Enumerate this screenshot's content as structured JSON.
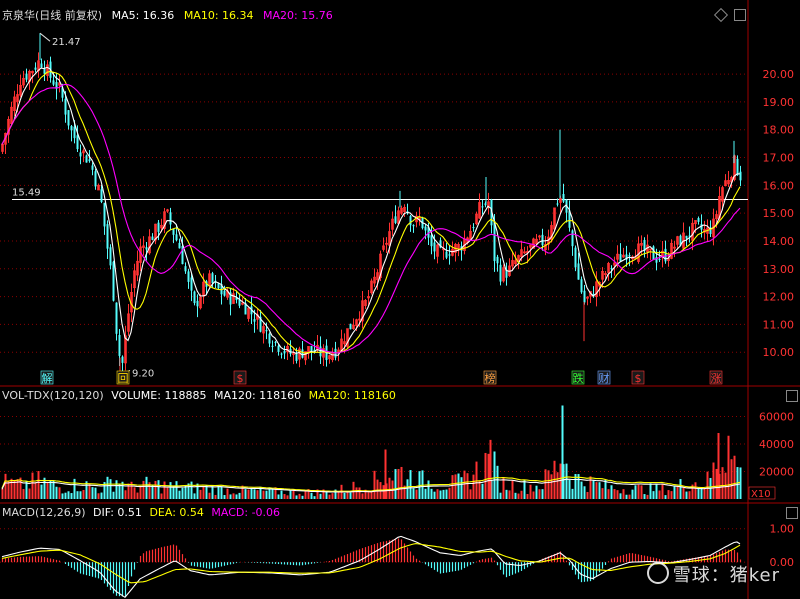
{
  "header": {
    "stock": "京泉华(日线 前复权)",
    "ma5": "MA5: 16.36",
    "ma10": "MA10: 16.34",
    "ma20": "MA20: 15.76"
  },
  "volume_header": {
    "title": "VOL-TDX(120,120)",
    "volume": "VOLUME: 118885",
    "ma120a": "MA120: 118160",
    "ma120b": "MA120: 118160"
  },
  "macd_header": {
    "title": "MACD(12,26,9)",
    "dif": "DIF: 0.51",
    "dea": "DEA: 0.54",
    "macd": "MACD: -0.06"
  },
  "watermark": "雪球：猪ker",
  "colors": {
    "up": "#ff3232",
    "down": "#54fcfc",
    "ma5": "#ffffff",
    "ma10": "#ffff00",
    "ma20": "#ff00ff",
    "grid": "#8b0000",
    "axis_text": "#ff3333"
  },
  "chart_data": [
    {
      "type": "candlestick",
      "title": "京泉华(日线 前复权)",
      "y_ticks": [
        "20.00",
        "19.00",
        "18.00",
        "17.00",
        "16.00",
        "15.00",
        "14.00",
        "13.00",
        "12.00",
        "11.00",
        "10.00"
      ],
      "ylim": [
        9.0,
        21.8
      ],
      "reference_line": {
        "value": 15.49,
        "label": "15.49"
      },
      "annotations": [
        {
          "label": "21.47",
          "value": 21.47,
          "x": 40
        },
        {
          "label": "9.20",
          "value": 9.2,
          "x": 120
        }
      ],
      "event_markers": [
        {
          "label": "解",
          "x": 47,
          "color": "#54fcfc"
        },
        {
          "label": "回",
          "x": 123,
          "color": "#ffd700"
        },
        {
          "label": "$",
          "x": 240,
          "color": "#ff3232"
        },
        {
          "label": "榜",
          "x": 490,
          "color": "#ffa040"
        },
        {
          "label": "跌",
          "x": 578,
          "color": "#32ff32"
        },
        {
          "label": "财",
          "x": 604,
          "color": "#6aa0ff"
        },
        {
          "label": "$",
          "x": 638,
          "color": "#ff3232"
        },
        {
          "label": "涨",
          "x": 716,
          "color": "#ff3232"
        }
      ],
      "close_keypoints": [
        [
          0,
          17.2
        ],
        [
          10,
          18.6
        ],
        [
          20,
          19.8
        ],
        [
          30,
          20.1
        ],
        [
          40,
          20.5
        ],
        [
          50,
          19.9
        ],
        [
          60,
          19.4
        ],
        [
          70,
          18.0
        ],
        [
          80,
          17.3
        ],
        [
          90,
          16.8
        ],
        [
          100,
          15.6
        ],
        [
          106,
          14.0
        ],
        [
          112,
          12.5
        ],
        [
          118,
          10.0
        ],
        [
          122,
          9.6
        ],
        [
          128,
          11.4
        ],
        [
          134,
          12.9
        ],
        [
          140,
          13.7
        ],
        [
          150,
          14.1
        ],
        [
          160,
          14.6
        ],
        [
          166,
          15.0
        ],
        [
          172,
          14.4
        ],
        [
          180,
          13.7
        ],
        [
          188,
          12.4
        ],
        [
          194,
          11.6
        ],
        [
          200,
          12.1
        ],
        [
          208,
          12.6
        ],
        [
          216,
          12.3
        ],
        [
          226,
          12.0
        ],
        [
          236,
          11.9
        ],
        [
          246,
          11.6
        ],
        [
          256,
          11.2
        ],
        [
          266,
          10.7
        ],
        [
          276,
          10.3
        ],
        [
          286,
          10.0
        ],
        [
          296,
          9.9
        ],
        [
          306,
          10.1
        ],
        [
          316,
          10.0
        ],
        [
          326,
          9.9
        ],
        [
          336,
          10.1
        ],
        [
          346,
          10.7
        ],
        [
          356,
          11.3
        ],
        [
          366,
          11.8
        ],
        [
          376,
          12.8
        ],
        [
          386,
          14.0
        ],
        [
          396,
          15.0
        ],
        [
          404,
          15.4
        ],
        [
          412,
          14.6
        ],
        [
          420,
          14.8
        ],
        [
          430,
          13.8
        ],
        [
          440,
          13.5
        ],
        [
          450,
          13.7
        ],
        [
          460,
          13.8
        ],
        [
          470,
          14.4
        ],
        [
          480,
          15.2
        ],
        [
          488,
          15.4
        ],
        [
          494,
          13.4
        ],
        [
          500,
          12.8
        ],
        [
          508,
          12.9
        ],
        [
          516,
          13.3
        ],
        [
          526,
          13.6
        ],
        [
          536,
          13.9
        ],
        [
          546,
          14.0
        ],
        [
          556,
          15.4
        ],
        [
          562,
          15.6
        ],
        [
          570,
          14.2
        ],
        [
          578,
          12.6
        ],
        [
          584,
          11.8
        ],
        [
          590,
          12.0
        ],
        [
          596,
          12.4
        ],
        [
          606,
          12.9
        ],
        [
          616,
          13.3
        ],
        [
          626,
          13.6
        ],
        [
          636,
          13.7
        ],
        [
          646,
          13.6
        ],
        [
          656,
          13.4
        ],
        [
          666,
          13.5
        ],
        [
          676,
          13.9
        ],
        [
          686,
          14.2
        ],
        [
          696,
          14.5
        ],
        [
          706,
          14.3
        ],
        [
          714,
          14.6
        ],
        [
          720,
          15.8
        ],
        [
          728,
          16.3
        ],
        [
          734,
          16.8
        ],
        [
          742,
          16.2
        ]
      ]
    },
    {
      "type": "bar",
      "title": "VOL-TDX(120,120)",
      "y_ticks": [
        "60000",
        "40000",
        "20000"
      ],
      "ylim": [
        0,
        72000
      ],
      "unit_label": "X10",
      "ma120_value": 11816,
      "volume_keypoints": [
        [
          0,
          14000
        ],
        [
          20,
          11000
        ],
        [
          40,
          15000
        ],
        [
          60,
          9000
        ],
        [
          80,
          12000
        ],
        [
          100,
          8000
        ],
        [
          115,
          16000
        ],
        [
          130,
          9000
        ],
        [
          150,
          12000
        ],
        [
          170,
          10000
        ],
        [
          200,
          9000
        ],
        [
          230,
          7000
        ],
        [
          260,
          6500
        ],
        [
          290,
          5500
        ],
        [
          320,
          5500
        ],
        [
          345,
          8000
        ],
        [
          370,
          13000
        ],
        [
          385,
          18000
        ],
        [
          400,
          22000
        ],
        [
          420,
          15000
        ],
        [
          440,
          12000
        ],
        [
          460,
          13000
        ],
        [
          480,
          24000
        ],
        [
          490,
          32000
        ],
        [
          500,
          13000
        ],
        [
          520,
          10000
        ],
        [
          540,
          11000
        ],
        [
          556,
          26000
        ],
        [
          562,
          40000
        ],
        [
          570,
          18000
        ],
        [
          590,
          13000
        ],
        [
          610,
          9000
        ],
        [
          640,
          8000
        ],
        [
          670,
          8000
        ],
        [
          690,
          14000
        ],
        [
          705,
          12000
        ],
        [
          718,
          30000
        ],
        [
          728,
          36000
        ],
        [
          742,
          20000
        ]
      ]
    },
    {
      "type": "bar",
      "title": "MACD(12,26,9)",
      "y_ticks": [
        "1.00",
        "0.00"
      ],
      "ylim": [
        -1.1,
        1.35
      ],
      "dif_keypoints": [
        [
          0,
          0.15
        ],
        [
          20,
          0.3
        ],
        [
          40,
          0.42
        ],
        [
          60,
          0.38
        ],
        [
          80,
          0.05
        ],
        [
          100,
          -0.3
        ],
        [
          115,
          -0.85
        ],
        [
          125,
          -1.05
        ],
        [
          140,
          -0.5
        ],
        [
          160,
          -0.18
        ],
        [
          175,
          0.05
        ],
        [
          190,
          -0.25
        ],
        [
          210,
          -0.38
        ],
        [
          240,
          -0.3
        ],
        [
          270,
          -0.32
        ],
        [
          300,
          -0.38
        ],
        [
          330,
          -0.3
        ],
        [
          360,
          0.05
        ],
        [
          380,
          0.4
        ],
        [
          400,
          0.78
        ],
        [
          415,
          0.62
        ],
        [
          440,
          0.28
        ],
        [
          460,
          0.2
        ],
        [
          480,
          0.34
        ],
        [
          492,
          0.4
        ],
        [
          505,
          -0.05
        ],
        [
          520,
          -0.1
        ],
        [
          540,
          0.04
        ],
        [
          560,
          0.28
        ],
        [
          570,
          0.05
        ],
        [
          580,
          -0.35
        ],
        [
          592,
          -0.5
        ],
        [
          610,
          -0.2
        ],
        [
          630,
          0.0
        ],
        [
          650,
          0.02
        ],
        [
          670,
          -0.02
        ],
        [
          690,
          0.08
        ],
        [
          710,
          0.2
        ],
        [
          725,
          0.45
        ],
        [
          736,
          0.62
        ],
        [
          742,
          0.51
        ]
      ],
      "dea_keypoints": [
        [
          0,
          0.1
        ],
        [
          20,
          0.22
        ],
        [
          40,
          0.33
        ],
        [
          60,
          0.36
        ],
        [
          80,
          0.22
        ],
        [
          100,
          -0.05
        ],
        [
          115,
          -0.35
        ],
        [
          130,
          -0.62
        ],
        [
          145,
          -0.58
        ],
        [
          160,
          -0.4
        ],
        [
          175,
          -0.22
        ],
        [
          190,
          -0.2
        ],
        [
          210,
          -0.28
        ],
        [
          240,
          -0.3
        ],
        [
          270,
          -0.3
        ],
        [
          300,
          -0.33
        ],
        [
          330,
          -0.32
        ],
        [
          360,
          -0.15
        ],
        [
          380,
          0.1
        ],
        [
          400,
          0.42
        ],
        [
          415,
          0.56
        ],
        [
          440,
          0.45
        ],
        [
          460,
          0.32
        ],
        [
          480,
          0.3
        ],
        [
          492,
          0.33
        ],
        [
          505,
          0.18
        ],
        [
          520,
          0.04
        ],
        [
          540,
          0.0
        ],
        [
          560,
          0.12
        ],
        [
          570,
          0.12
        ],
        [
          580,
          -0.05
        ],
        [
          592,
          -0.22
        ],
        [
          610,
          -0.25
        ],
        [
          630,
          -0.14
        ],
        [
          650,
          -0.06
        ],
        [
          670,
          -0.03
        ],
        [
          690,
          0.02
        ],
        [
          710,
          0.1
        ],
        [
          725,
          0.26
        ],
        [
          736,
          0.44
        ],
        [
          742,
          0.54
        ]
      ]
    }
  ]
}
